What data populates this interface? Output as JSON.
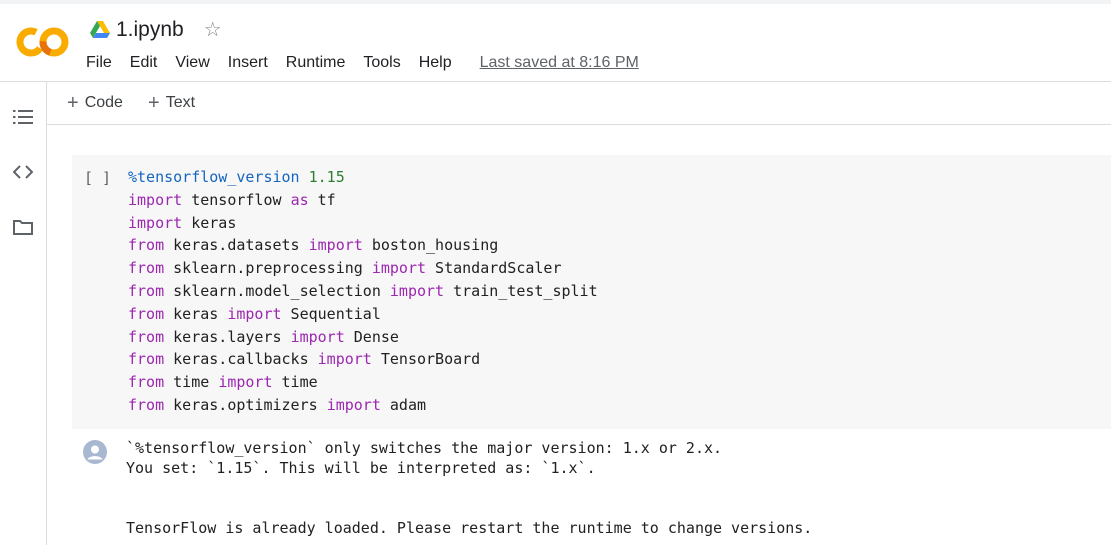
{
  "header": {
    "logo_text": "CO",
    "title": "1.ipynb",
    "menu": [
      "File",
      "Edit",
      "View",
      "Insert",
      "Runtime",
      "Tools",
      "Help"
    ],
    "last_saved": "Last saved at 8:16 PM"
  },
  "rail": {
    "icons": [
      "table-of-contents-icon",
      "code-snippets-icon",
      "folder-icon"
    ]
  },
  "toolbar": {
    "code_label": "Code",
    "text_label": "Text"
  },
  "cell": {
    "run_label": "[ ]",
    "lines": [
      [
        {
          "t": "%tensorflow_version",
          "c": "magic"
        },
        {
          "t": " "
        },
        {
          "t": "1.15",
          "c": "num"
        }
      ],
      [
        {
          "t": "import",
          "c": "kw"
        },
        {
          "t": " tensorflow "
        },
        {
          "t": "as",
          "c": "kw"
        },
        {
          "t": " tf"
        }
      ],
      [
        {
          "t": "import",
          "c": "kw"
        },
        {
          "t": " keras"
        }
      ],
      [
        {
          "t": "from",
          "c": "kw"
        },
        {
          "t": " keras.datasets "
        },
        {
          "t": "import",
          "c": "kw"
        },
        {
          "t": " boston_housing"
        }
      ],
      [
        {
          "t": "from",
          "c": "kw"
        },
        {
          "t": " sklearn.preprocessing "
        },
        {
          "t": "import",
          "c": "kw"
        },
        {
          "t": " StandardScaler"
        }
      ],
      [
        {
          "t": "from",
          "c": "kw"
        },
        {
          "t": " sklearn.model_selection "
        },
        {
          "t": "import",
          "c": "kw"
        },
        {
          "t": " train_test_split"
        }
      ],
      [
        {
          "t": "from",
          "c": "kw"
        },
        {
          "t": " keras "
        },
        {
          "t": "import",
          "c": "kw"
        },
        {
          "t": " Sequential"
        }
      ],
      [
        {
          "t": "from",
          "c": "kw"
        },
        {
          "t": " keras.layers "
        },
        {
          "t": "import",
          "c": "kw"
        },
        {
          "t": " Dense"
        }
      ],
      [
        {
          "t": "from",
          "c": "kw"
        },
        {
          "t": " keras.callbacks "
        },
        {
          "t": "import",
          "c": "kw"
        },
        {
          "t": " TensorBoard"
        }
      ],
      [
        {
          "t": "from",
          "c": "kw"
        },
        {
          "t": " time "
        },
        {
          "t": "import",
          "c": "kw"
        },
        {
          "t": " time"
        }
      ],
      [
        {
          "t": "from",
          "c": "kw"
        },
        {
          "t": " keras.optimizers "
        },
        {
          "t": "import",
          "c": "kw"
        },
        {
          "t": " adam"
        }
      ]
    ]
  },
  "output": {
    "text": "`%tensorflow_version` only switches the major version: 1.x or 2.x.\nYou set: `1.15`. This will be interpreted as: `1.x`.\n\n\nTensorFlow is already loaded. Please restart the runtime to change versions."
  },
  "colors": {
    "logo_orange": "#f9ab00",
    "keyword": "#9c27b0",
    "magic": "#1565c0",
    "number": "#2e7d32"
  }
}
